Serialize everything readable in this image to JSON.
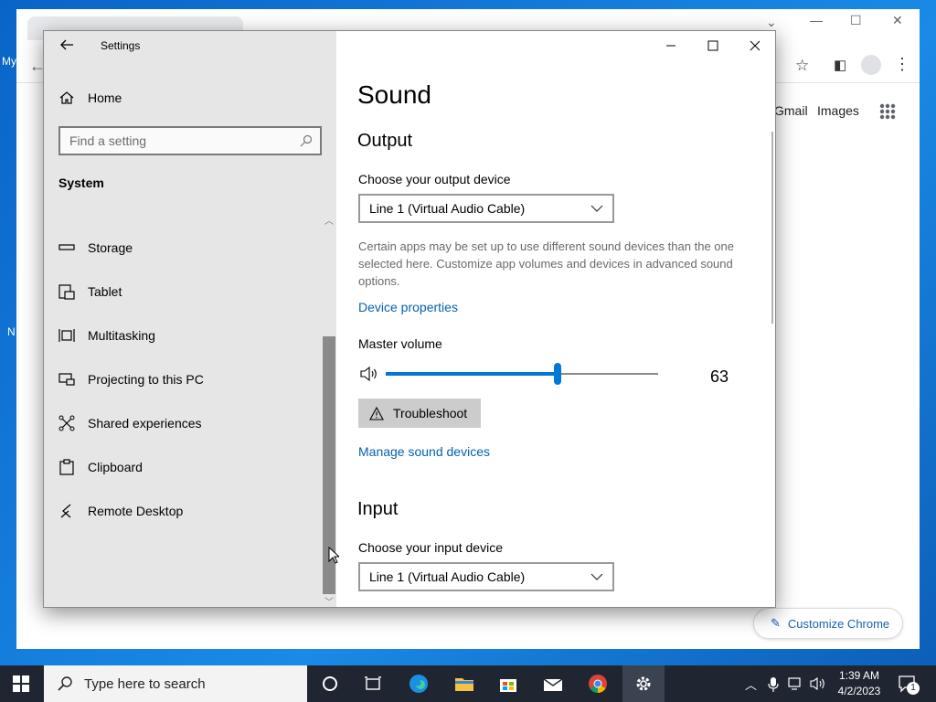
{
  "desktop": {
    "frag_top": "My",
    "frag_mid": "N"
  },
  "chrome": {
    "links": [
      "Gmail",
      "Images"
    ],
    "customize_label": "Customize Chrome"
  },
  "settings": {
    "title": "Settings",
    "home": "Home",
    "search_placeholder": "Find a setting",
    "category": "System",
    "nav_items": [
      "Storage",
      "Tablet",
      "Multitasking",
      "Projecting to this PC",
      "Shared experiences",
      "Clipboard",
      "Remote Desktop"
    ]
  },
  "sound": {
    "title": "Sound",
    "output": {
      "heading": "Output",
      "device_label": "Choose your output device",
      "device_value": "Line 1 (Virtual Audio Cable)",
      "description": "Certain apps may be set up to use different sound devices than the one selected here. Customize app volumes and devices in advanced sound options.",
      "device_properties": "Device properties",
      "master_volume_label": "Master volume",
      "master_volume": 63,
      "troubleshoot": "Troubleshoot",
      "manage_devices": "Manage sound devices"
    },
    "input": {
      "heading": "Input",
      "device_label": "Choose your input device",
      "device_value": "Line 1 (Virtual Audio Cable)"
    }
  },
  "taskbar": {
    "search_placeholder": "Type here to search",
    "time": "1:39 AM",
    "date": "4/2/2023",
    "notification_count": "1"
  },
  "colors": {
    "accent": "#0078d7",
    "link": "#0063b1",
    "taskbar": "#1f2632"
  }
}
